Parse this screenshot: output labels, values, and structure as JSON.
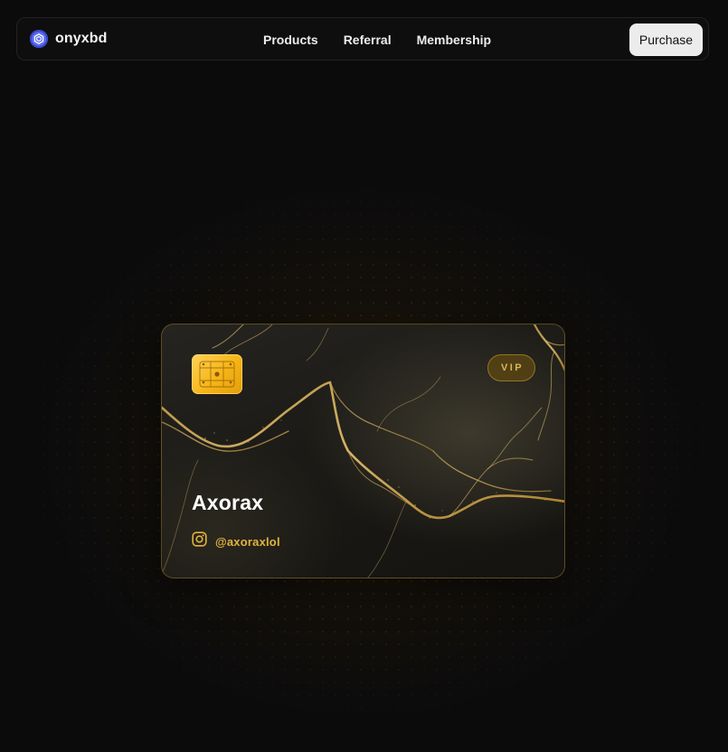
{
  "navbar": {
    "brand_name": "onyxbd",
    "brand_icon": "hexagon-logo-icon",
    "links": [
      {
        "label": "Products"
      },
      {
        "label": "Referral"
      },
      {
        "label": "Membership"
      }
    ],
    "purchase_label": "Purchase"
  },
  "card": {
    "badge": "VIP",
    "name": "Axorax",
    "handle": "@axoraxlol",
    "handle_icon": "instagram-icon",
    "chip_icon": "card-chip-icon",
    "colors": {
      "accent_gold": "#e2b33d",
      "chip": "#f6b516"
    }
  }
}
